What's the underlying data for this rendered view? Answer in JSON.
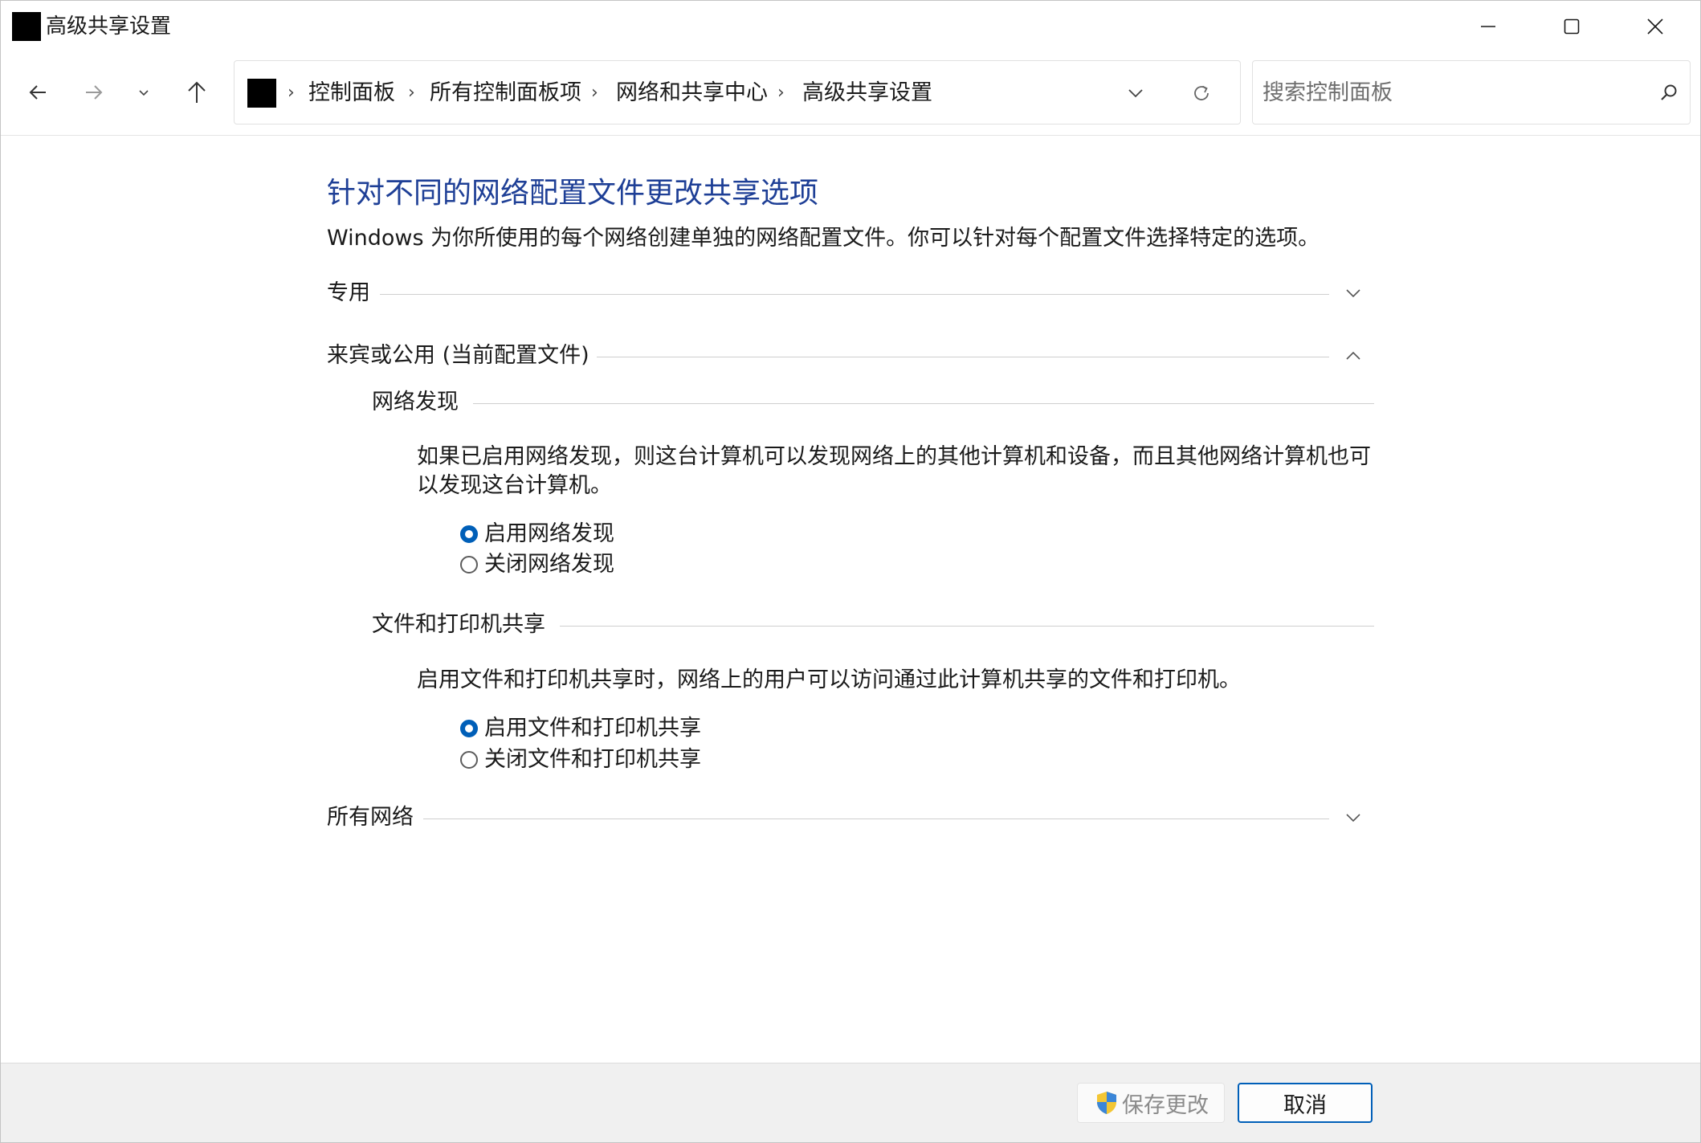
{
  "window": {
    "title": "高级共享设置"
  },
  "nav": {
    "breadcrumb": [
      "控制面板",
      "所有控制面板项",
      "网络和共享中心",
      "高级共享设置"
    ],
    "separator": "›"
  },
  "search": {
    "placeholder": "搜索控制面板",
    "value": ""
  },
  "main": {
    "title": "针对不同的网络配置文件更改共享选项",
    "description": "Windows 为你所使用的每个网络创建单独的网络配置文件。你可以针对每个配置文件选择特定的选项。",
    "sections": [
      {
        "label": "专用",
        "expanded": false
      },
      {
        "label": "来宾或公用 (当前配置文件)",
        "expanded": true
      },
      {
        "label": "所有网络",
        "expanded": false
      }
    ],
    "network_discovery": {
      "heading": "网络发现",
      "description": "如果已启用网络发现，则这台计算机可以发现网络上的其他计算机和设备，而且其他网络计算机也可以发现这台计算机。",
      "options": [
        {
          "label": "启用网络发现",
          "selected": true
        },
        {
          "label": "关闭网络发现",
          "selected": false
        }
      ]
    },
    "file_printer_sharing": {
      "heading": "文件和打印机共享",
      "description": "启用文件和打印机共享时，网络上的用户可以访问通过此计算机共享的文件和打印机。",
      "options": [
        {
          "label": "启用文件和打印机共享",
          "selected": true
        },
        {
          "label": "关闭文件和打印机共享",
          "selected": false
        }
      ]
    }
  },
  "footer": {
    "save_label": "保存更改",
    "cancel_label": "取消"
  },
  "colors": {
    "title_blue": "#1e3f96",
    "accent": "#005fb8",
    "footer_bg": "#f0f0f0"
  },
  "icons": [
    "app-icon",
    "minimize-icon",
    "maximize-icon",
    "close-icon",
    "back-arrow-icon",
    "forward-arrow-icon",
    "recent-locations-icon",
    "up-arrow-icon",
    "control-panel-icon",
    "chevron-right-icon",
    "dropdown-chevron-icon",
    "refresh-icon",
    "search-icon",
    "chevron-down-icon",
    "chevron-up-icon",
    "uac-shield-icon"
  ]
}
